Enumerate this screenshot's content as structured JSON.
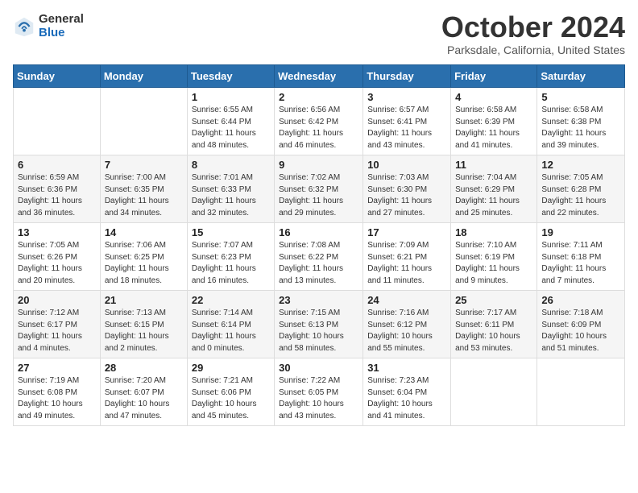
{
  "logo": {
    "general": "General",
    "blue": "Blue"
  },
  "header": {
    "month": "October 2024",
    "location": "Parksdale, California, United States"
  },
  "weekdays": [
    "Sunday",
    "Monday",
    "Tuesday",
    "Wednesday",
    "Thursday",
    "Friday",
    "Saturday"
  ],
  "weeks": [
    [
      {
        "day": "",
        "sunrise": "",
        "sunset": "",
        "daylight": ""
      },
      {
        "day": "",
        "sunrise": "",
        "sunset": "",
        "daylight": ""
      },
      {
        "day": "1",
        "sunrise": "Sunrise: 6:55 AM",
        "sunset": "Sunset: 6:44 PM",
        "daylight": "Daylight: 11 hours and 48 minutes."
      },
      {
        "day": "2",
        "sunrise": "Sunrise: 6:56 AM",
        "sunset": "Sunset: 6:42 PM",
        "daylight": "Daylight: 11 hours and 46 minutes."
      },
      {
        "day": "3",
        "sunrise": "Sunrise: 6:57 AM",
        "sunset": "Sunset: 6:41 PM",
        "daylight": "Daylight: 11 hours and 43 minutes."
      },
      {
        "day": "4",
        "sunrise": "Sunrise: 6:58 AM",
        "sunset": "Sunset: 6:39 PM",
        "daylight": "Daylight: 11 hours and 41 minutes."
      },
      {
        "day": "5",
        "sunrise": "Sunrise: 6:58 AM",
        "sunset": "Sunset: 6:38 PM",
        "daylight": "Daylight: 11 hours and 39 minutes."
      }
    ],
    [
      {
        "day": "6",
        "sunrise": "Sunrise: 6:59 AM",
        "sunset": "Sunset: 6:36 PM",
        "daylight": "Daylight: 11 hours and 36 minutes."
      },
      {
        "day": "7",
        "sunrise": "Sunrise: 7:00 AM",
        "sunset": "Sunset: 6:35 PM",
        "daylight": "Daylight: 11 hours and 34 minutes."
      },
      {
        "day": "8",
        "sunrise": "Sunrise: 7:01 AM",
        "sunset": "Sunset: 6:33 PM",
        "daylight": "Daylight: 11 hours and 32 minutes."
      },
      {
        "day": "9",
        "sunrise": "Sunrise: 7:02 AM",
        "sunset": "Sunset: 6:32 PM",
        "daylight": "Daylight: 11 hours and 29 minutes."
      },
      {
        "day": "10",
        "sunrise": "Sunrise: 7:03 AM",
        "sunset": "Sunset: 6:30 PM",
        "daylight": "Daylight: 11 hours and 27 minutes."
      },
      {
        "day": "11",
        "sunrise": "Sunrise: 7:04 AM",
        "sunset": "Sunset: 6:29 PM",
        "daylight": "Daylight: 11 hours and 25 minutes."
      },
      {
        "day": "12",
        "sunrise": "Sunrise: 7:05 AM",
        "sunset": "Sunset: 6:28 PM",
        "daylight": "Daylight: 11 hours and 22 minutes."
      }
    ],
    [
      {
        "day": "13",
        "sunrise": "Sunrise: 7:05 AM",
        "sunset": "Sunset: 6:26 PM",
        "daylight": "Daylight: 11 hours and 20 minutes."
      },
      {
        "day": "14",
        "sunrise": "Sunrise: 7:06 AM",
        "sunset": "Sunset: 6:25 PM",
        "daylight": "Daylight: 11 hours and 18 minutes."
      },
      {
        "day": "15",
        "sunrise": "Sunrise: 7:07 AM",
        "sunset": "Sunset: 6:23 PM",
        "daylight": "Daylight: 11 hours and 16 minutes."
      },
      {
        "day": "16",
        "sunrise": "Sunrise: 7:08 AM",
        "sunset": "Sunset: 6:22 PM",
        "daylight": "Daylight: 11 hours and 13 minutes."
      },
      {
        "day": "17",
        "sunrise": "Sunrise: 7:09 AM",
        "sunset": "Sunset: 6:21 PM",
        "daylight": "Daylight: 11 hours and 11 minutes."
      },
      {
        "day": "18",
        "sunrise": "Sunrise: 7:10 AM",
        "sunset": "Sunset: 6:19 PM",
        "daylight": "Daylight: 11 hours and 9 minutes."
      },
      {
        "day": "19",
        "sunrise": "Sunrise: 7:11 AM",
        "sunset": "Sunset: 6:18 PM",
        "daylight": "Daylight: 11 hours and 7 minutes."
      }
    ],
    [
      {
        "day": "20",
        "sunrise": "Sunrise: 7:12 AM",
        "sunset": "Sunset: 6:17 PM",
        "daylight": "Daylight: 11 hours and 4 minutes."
      },
      {
        "day": "21",
        "sunrise": "Sunrise: 7:13 AM",
        "sunset": "Sunset: 6:15 PM",
        "daylight": "Daylight: 11 hours and 2 minutes."
      },
      {
        "day": "22",
        "sunrise": "Sunrise: 7:14 AM",
        "sunset": "Sunset: 6:14 PM",
        "daylight": "Daylight: 11 hours and 0 minutes."
      },
      {
        "day": "23",
        "sunrise": "Sunrise: 7:15 AM",
        "sunset": "Sunset: 6:13 PM",
        "daylight": "Daylight: 10 hours and 58 minutes."
      },
      {
        "day": "24",
        "sunrise": "Sunrise: 7:16 AM",
        "sunset": "Sunset: 6:12 PM",
        "daylight": "Daylight: 10 hours and 55 minutes."
      },
      {
        "day": "25",
        "sunrise": "Sunrise: 7:17 AM",
        "sunset": "Sunset: 6:11 PM",
        "daylight": "Daylight: 10 hours and 53 minutes."
      },
      {
        "day": "26",
        "sunrise": "Sunrise: 7:18 AM",
        "sunset": "Sunset: 6:09 PM",
        "daylight": "Daylight: 10 hours and 51 minutes."
      }
    ],
    [
      {
        "day": "27",
        "sunrise": "Sunrise: 7:19 AM",
        "sunset": "Sunset: 6:08 PM",
        "daylight": "Daylight: 10 hours and 49 minutes."
      },
      {
        "day": "28",
        "sunrise": "Sunrise: 7:20 AM",
        "sunset": "Sunset: 6:07 PM",
        "daylight": "Daylight: 10 hours and 47 minutes."
      },
      {
        "day": "29",
        "sunrise": "Sunrise: 7:21 AM",
        "sunset": "Sunset: 6:06 PM",
        "daylight": "Daylight: 10 hours and 45 minutes."
      },
      {
        "day": "30",
        "sunrise": "Sunrise: 7:22 AM",
        "sunset": "Sunset: 6:05 PM",
        "daylight": "Daylight: 10 hours and 43 minutes."
      },
      {
        "day": "31",
        "sunrise": "Sunrise: 7:23 AM",
        "sunset": "Sunset: 6:04 PM",
        "daylight": "Daylight: 10 hours and 41 minutes."
      },
      {
        "day": "",
        "sunrise": "",
        "sunset": "",
        "daylight": ""
      },
      {
        "day": "",
        "sunrise": "",
        "sunset": "",
        "daylight": ""
      }
    ]
  ]
}
